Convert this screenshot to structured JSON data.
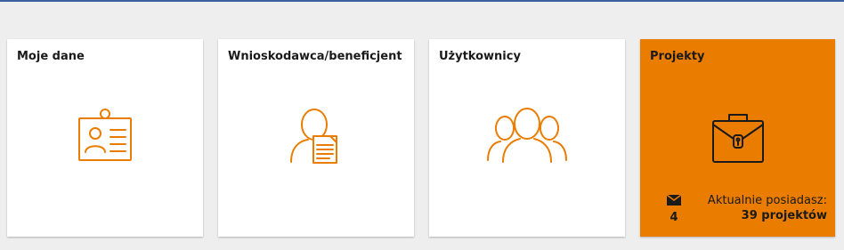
{
  "colors": {
    "accent": "#ea7d00",
    "top_bar": "#3b5e9e",
    "background": "#eeeeee",
    "tile": "#ffffff"
  },
  "tiles": [
    {
      "title": "Moje dane",
      "icon": "id-badge-icon"
    },
    {
      "title": "Wnioskodawca/beneficjent",
      "icon": "applicant-document-icon"
    },
    {
      "title": "Użytkownicy",
      "icon": "users-group-icon"
    },
    {
      "title": "Projekty",
      "icon": "briefcase-icon"
    }
  ],
  "projects": {
    "messages_icon": "envelope-icon",
    "messages_count": "4",
    "info_label": "Aktualnie posiadasz:",
    "info_value": "39 projektów"
  }
}
